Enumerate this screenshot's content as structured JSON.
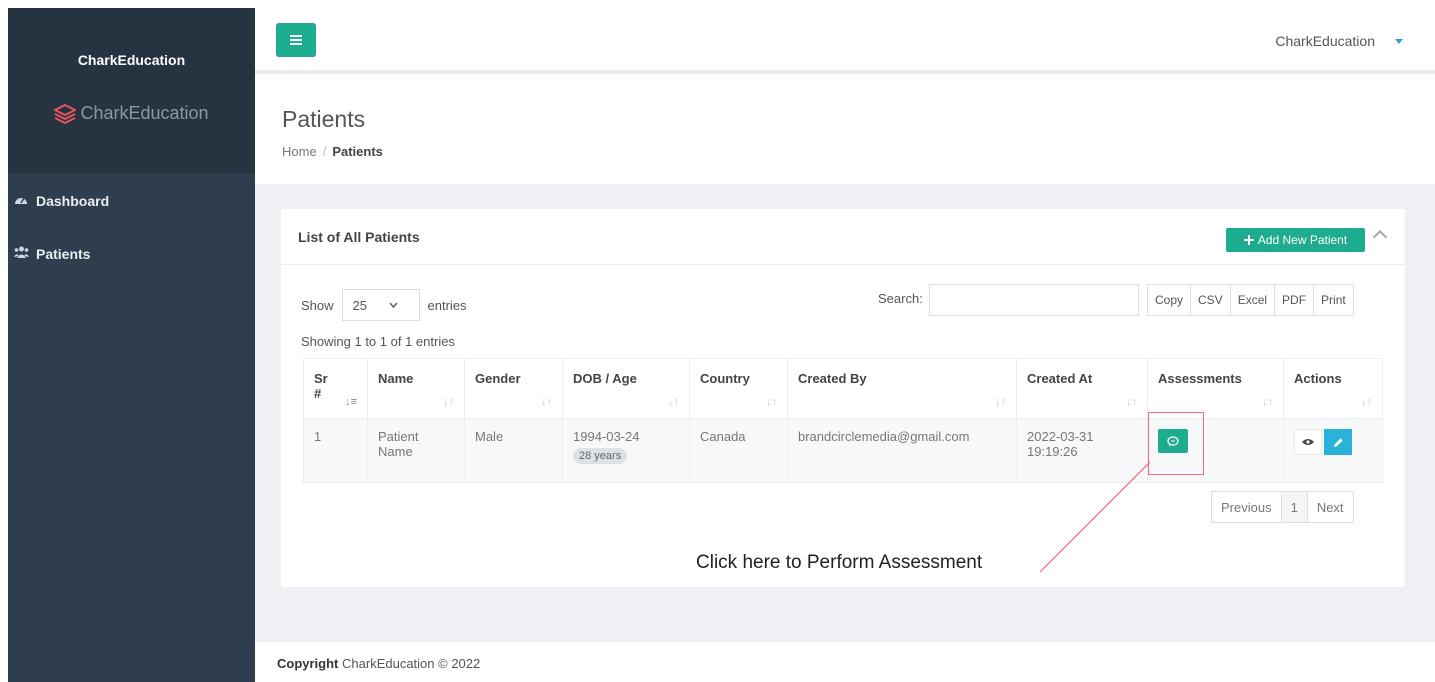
{
  "sidebar": {
    "brand_title": "CharkEducation",
    "logo_text": "CharkEducation",
    "items": [
      {
        "label": "Dashboard",
        "icon": "dashboard-icon"
      },
      {
        "label": "Patients",
        "icon": "users-icon"
      }
    ]
  },
  "header": {
    "user_name": "CharkEducation"
  },
  "page": {
    "title": "Patients",
    "breadcrumb": {
      "home": "Home",
      "separator": "/",
      "current": "Patients"
    }
  },
  "card": {
    "title": "List of All Patients",
    "add_button": "Add New Patient",
    "show_label": "Show",
    "entries_label": "entries",
    "page_length": "25",
    "search_label": "Search:",
    "search_value": "",
    "export_buttons": [
      "Copy",
      "CSV",
      "Excel",
      "PDF",
      "Print"
    ],
    "info": "Showing 1 to 1 of 1 entries"
  },
  "table": {
    "headers": [
      "Sr #",
      "Name",
      "Gender",
      "DOB / Age",
      "Country",
      "Created By",
      "Created At",
      "Assessments",
      "Actions"
    ],
    "rows": [
      {
        "sr": "1",
        "name": "Patient Name",
        "gender": "Male",
        "dob": "1994-03-24",
        "age": "28 years",
        "country": "Canada",
        "created_by": "brandcirclemedia@gmail.com",
        "created_at": "2022-03-31 19:19:26"
      }
    ]
  },
  "pagination": {
    "previous": "Previous",
    "current": "1",
    "next": "Next"
  },
  "annotation": "Click here to Perform Assessment",
  "footer": {
    "prefix": "Copyright",
    "text": "CharkEducation © 2022"
  },
  "colors": {
    "primary": "#1eac8f",
    "info": "#2bb2da",
    "sidebar": "#2f3e4e",
    "annotation": "#f06b78"
  }
}
